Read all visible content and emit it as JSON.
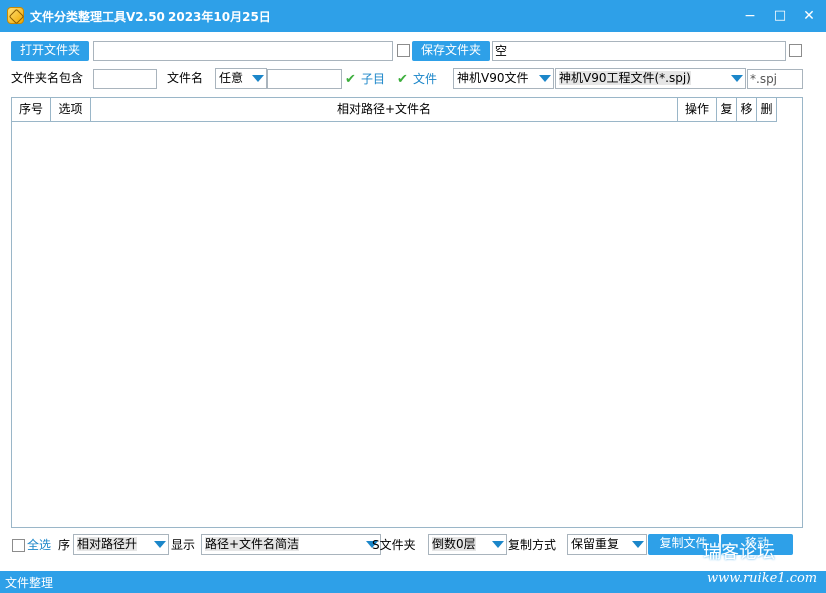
{
  "window": {
    "title": "文件分类整理工具V2.50",
    "date": "2023年10月25日",
    "controls": {
      "minimize": "−",
      "maximize": "□",
      "close": "✕"
    }
  },
  "row1": {
    "open_folder_button": "打开文件夹",
    "open_folder_path": "",
    "save_folder_button": "保存文件夹",
    "save_folder_path": "空"
  },
  "row2": {
    "folder_contains_label": "文件夹名包含",
    "folder_contains_value": "",
    "file_name_label": "文件名",
    "file_name_mode": "任意",
    "file_name_value": "",
    "subdir_label": "子目",
    "subdir_checked": true,
    "file_label": "文件",
    "file_checked": true,
    "file_type_category": "神机V90文件",
    "file_type_detail": "神机V90工程文件(*.spj)",
    "extension": "*.spj"
  },
  "table": {
    "columns": [
      "序号",
      "选项",
      "相对路径+文件名",
      "操作",
      "复",
      "移",
      "删"
    ],
    "rows": []
  },
  "bottom": {
    "select_all_label": "全选",
    "select_all_checked": false,
    "order_label": "序",
    "order_value": "相对路径升",
    "display_label": "显示",
    "display_value": "路径+文件名简洁",
    "folder_label": "S文件夹",
    "folder_value": "倒数0层",
    "copy_mode_label": "复制方式",
    "copy_mode_value": "保留重复",
    "copy_files_button": "复制文件",
    "move_button": "移动"
  },
  "status": {
    "text": "文件整理",
    "watermark": "瑞客论坛",
    "watermark_url": "www.ruike1.com"
  },
  "colors": {
    "accent": "#2ea0e8",
    "check_green": "#3cae3c",
    "border": "#a9b4bd"
  }
}
